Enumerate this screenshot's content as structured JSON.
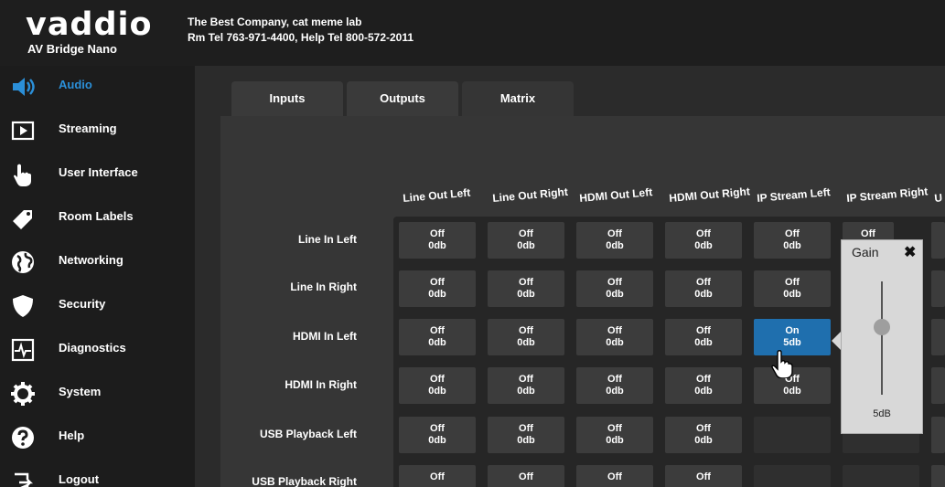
{
  "header": {
    "brand": "vaddio",
    "product": "AV Bridge Nano",
    "company_line1": "The Best Company, cat meme lab",
    "company_line2": "Rm Tel 763-971-4400, Help Tel 800-572-2011"
  },
  "sidebar": {
    "items": [
      {
        "label": "Audio",
        "icon": "speaker-icon",
        "active": true
      },
      {
        "label": "Streaming",
        "icon": "play-icon"
      },
      {
        "label": "User Interface",
        "icon": "pointer-hand-icon"
      },
      {
        "label": "Room Labels",
        "icon": "tag-icon"
      },
      {
        "label": "Networking",
        "icon": "globe-icon"
      },
      {
        "label": "Security",
        "icon": "shield-icon"
      },
      {
        "label": "Diagnostics",
        "icon": "pulse-icon"
      },
      {
        "label": "System",
        "icon": "gear-icon"
      },
      {
        "label": "Help",
        "icon": "help-icon"
      },
      {
        "label": "Logout",
        "icon": "logout-icon"
      }
    ]
  },
  "tabs": [
    {
      "label": "Inputs"
    },
    {
      "label": "Outputs"
    },
    {
      "label": "Matrix",
      "active": true
    }
  ],
  "matrix": {
    "columns": [
      "Line Out Left",
      "Line Out Right",
      "HDMI Out Left",
      "HDMI Out Right",
      "IP Stream Left",
      "IP Stream Right",
      "U"
    ],
    "rows": [
      "Line In Left",
      "Line In Right",
      "HDMI In Left",
      "HDMI In Right",
      "USB Playback Left",
      "USB Playback Right"
    ],
    "cells": [
      [
        {
          "state": "Off",
          "gain": "0db"
        },
        {
          "state": "Off",
          "gain": "0db"
        },
        {
          "state": "Off",
          "gain": "0db"
        },
        {
          "state": "Off",
          "gain": "0db"
        },
        {
          "state": "Off",
          "gain": "0db"
        },
        {
          "state": "Off",
          "gain": ""
        }
      ],
      [
        {
          "state": "Off",
          "gain": "0db"
        },
        {
          "state": "Off",
          "gain": "0db"
        },
        {
          "state": "Off",
          "gain": "0db"
        },
        {
          "state": "Off",
          "gain": "0db"
        },
        {
          "state": "Off",
          "gain": "0db"
        }
      ],
      [
        {
          "state": "Off",
          "gain": "0db"
        },
        {
          "state": "Off",
          "gain": "0db"
        },
        {
          "state": "Off",
          "gain": "0db"
        },
        {
          "state": "Off",
          "gain": "0db"
        },
        {
          "state": "On",
          "gain": "5db",
          "on": true
        }
      ],
      [
        {
          "state": "Off",
          "gain": "0db"
        },
        {
          "state": "Off",
          "gain": "0db"
        },
        {
          "state": "Off",
          "gain": "0db"
        },
        {
          "state": "Off",
          "gain": "0db"
        },
        {
          "state": "Off",
          "gain": "0db"
        }
      ],
      [
        {
          "state": "Off",
          "gain": "0db"
        },
        {
          "state": "Off",
          "gain": "0db"
        },
        {
          "state": "Off",
          "gain": "0db"
        },
        {
          "state": "Off",
          "gain": "0db"
        }
      ],
      [
        {
          "state": "Off",
          "gain": ""
        },
        {
          "state": "Off",
          "gain": ""
        },
        {
          "state": "Off",
          "gain": ""
        },
        {
          "state": "Off",
          "gain": ""
        }
      ]
    ]
  },
  "gain_popup": {
    "title": "Gain",
    "close": "✖",
    "value": "5dB",
    "level": 0.6
  },
  "colors": {
    "accent": "#2b8fd8",
    "cell_on": "#1f6fae",
    "cell_off": "#3c3c3c"
  }
}
